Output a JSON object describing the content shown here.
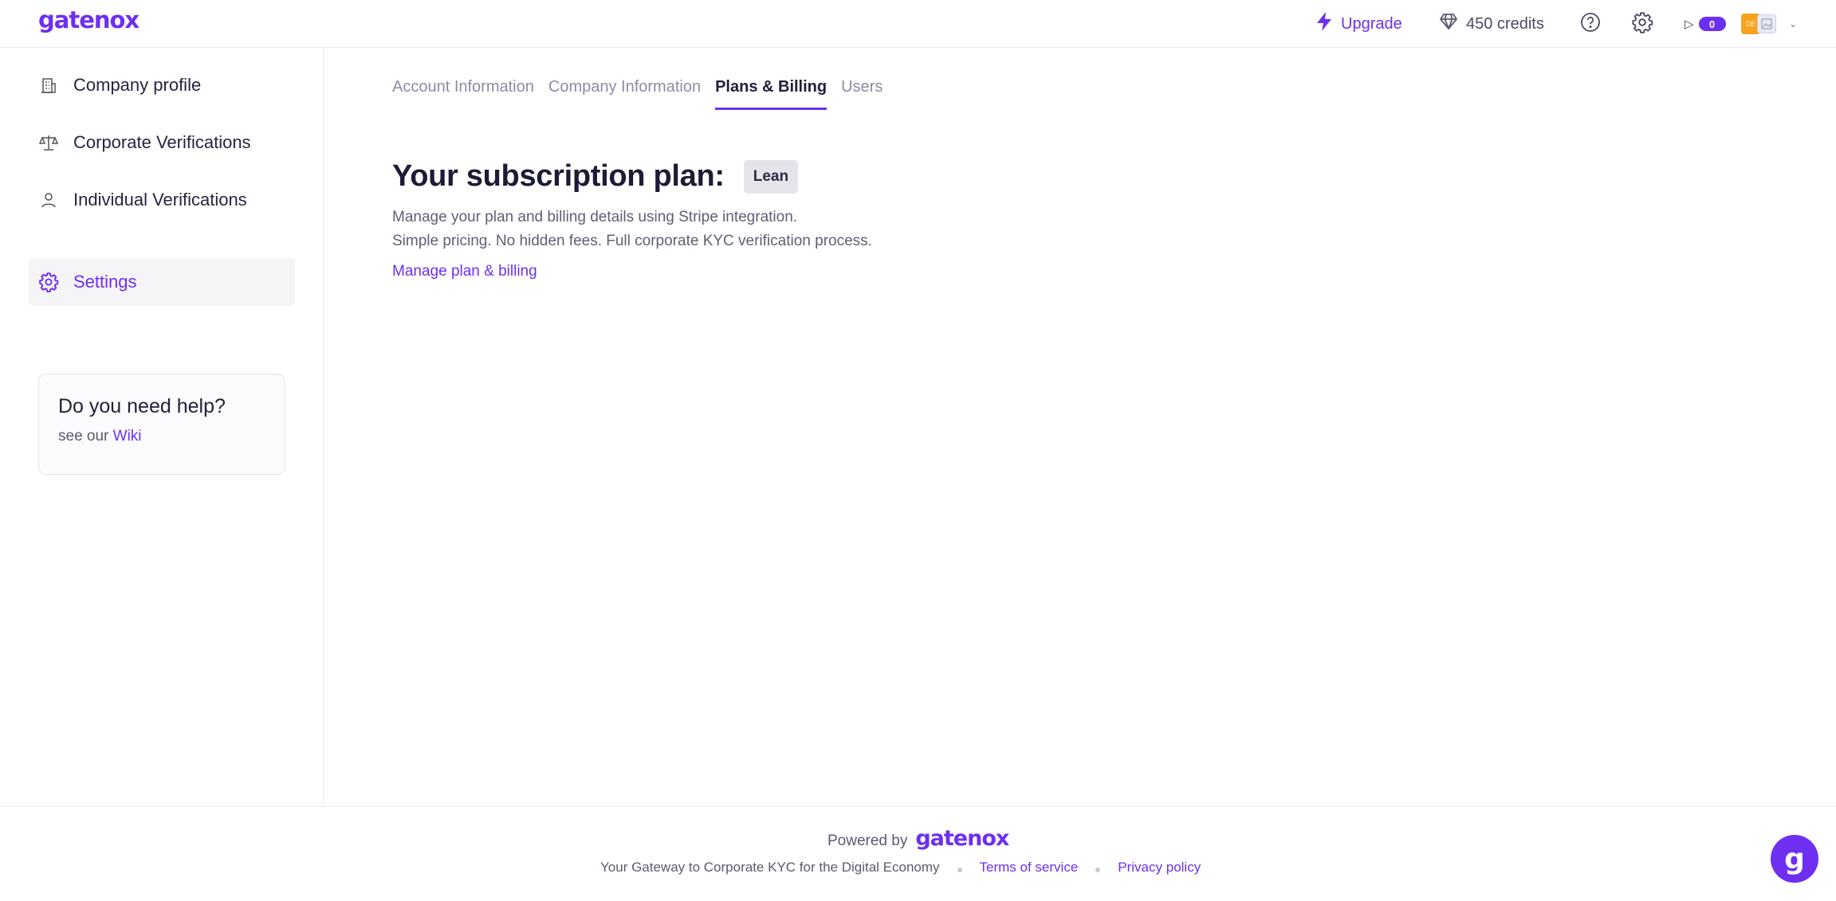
{
  "brand": {
    "logo_text": "gatenox",
    "accent_color": "#6e2ff0"
  },
  "topbar": {
    "upgrade_label": "Upgrade",
    "credits_label": "450 credits",
    "notification_count": "0",
    "avatar_initials": "DE",
    "icons": [
      "bolt-icon",
      "diamond-icon",
      "help-circle-icon",
      "gear-icon",
      "send-icon",
      "chevron-down-icon"
    ]
  },
  "sidebar": {
    "items": [
      {
        "label": "Company profile",
        "icon": "building-icon",
        "active": false
      },
      {
        "label": "Corporate Verifications",
        "icon": "scale-icon",
        "active": false
      },
      {
        "label": "Individual Verifications",
        "icon": "user-icon",
        "active": false
      },
      {
        "label": "Settings",
        "icon": "gear-icon",
        "active": true
      }
    ],
    "help": {
      "title": "Do you need help?",
      "prefix": "see our ",
      "link": "Wiki"
    }
  },
  "main": {
    "tabs": [
      {
        "label": "Account Information",
        "active": false
      },
      {
        "label": "Company Information",
        "active": false
      },
      {
        "label": "Plans & Billing",
        "active": true
      },
      {
        "label": "Users",
        "active": false
      }
    ],
    "plan_title": "Your subscription plan:",
    "plan_badge": "Lean",
    "desc_line1": "Manage your plan and billing details using Stripe integration.",
    "desc_line2": "Simple pricing. No hidden fees. Full corporate KYC verification process.",
    "manage_link": "Manage plan & billing"
  },
  "footer": {
    "powered_by": "Powered by",
    "logo_text": "gatenox",
    "tagline": "Your Gateway to Corporate KYC for the Digital Economy",
    "terms": "Terms of service",
    "privacy": "Privacy policy"
  },
  "chat": {
    "glyph": "g"
  }
}
